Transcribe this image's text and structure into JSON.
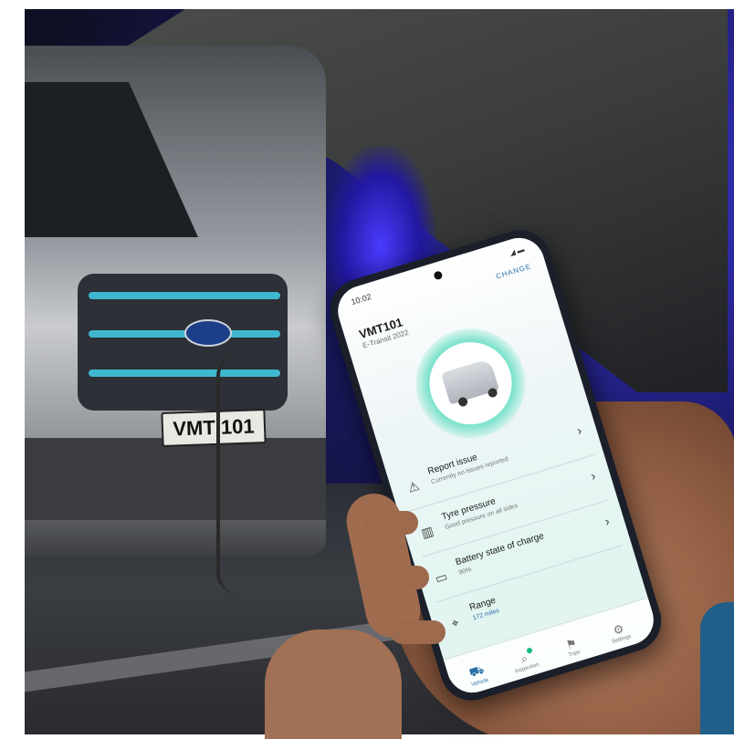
{
  "phone": {
    "status_time": "10:02",
    "status_icons": "◢ ▬",
    "change_label": "CHANGE",
    "vehicle_id": "VMT101",
    "vehicle_model": "E-Transit 2022",
    "rows": [
      {
        "title": "Report issue",
        "subtitle": "Currently no issues reported",
        "icon": "warning-icon"
      },
      {
        "title": "Tyre pressure",
        "subtitle": "Good pressure on all sides",
        "icon": "tyre-icon"
      },
      {
        "title": "Battery state of charge",
        "subtitle": "90%",
        "icon": "battery-icon"
      },
      {
        "title": "Range",
        "subtitle": "172 miles",
        "icon": "range-icon"
      }
    ],
    "tabs": [
      {
        "label": "Vehicle",
        "icon": "van-icon"
      },
      {
        "label": "Inspection",
        "icon": "search-icon"
      },
      {
        "label": "Trips",
        "icon": "trips-icon"
      },
      {
        "label": "Settings",
        "icon": "gear-icon"
      }
    ]
  },
  "van": {
    "plate": "VMT 101"
  }
}
